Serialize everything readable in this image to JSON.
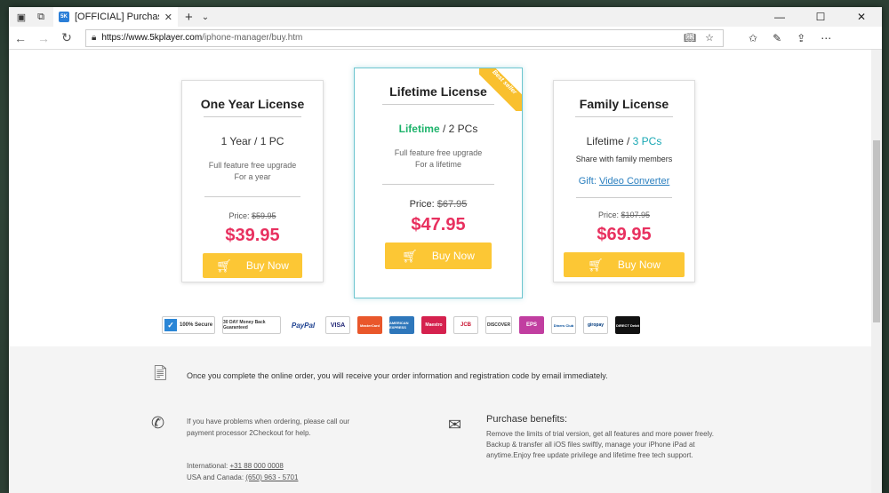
{
  "browser": {
    "tab_title": "[OFFICIAL] Purchase De",
    "tab_favicon": "5K",
    "url_host": "https://www.5kplayer.com",
    "url_path": "/iphone-manager/buy.htm"
  },
  "cards": [
    {
      "title": "One Year License",
      "term_left": "1 Year",
      "term_sep": " / ",
      "term_right": "1 PC",
      "desc1": "Full feature free upgrade",
      "desc2": "For a year",
      "price_label": "Price:",
      "old_price": "$59.95",
      "price": "$39.95",
      "buy_label": "Buy Now"
    },
    {
      "title": "Lifetime License",
      "term_left": "Lifetime",
      "term_sep": " / ",
      "term_right": "2 PCs",
      "desc1": "Full feature free upgrade",
      "desc2": "For a lifetime",
      "price_label": "Price:",
      "old_price": "$67.95",
      "price": "$47.95",
      "buy_label": "Buy Now",
      "ribbon": "Best seller"
    },
    {
      "title": "Family License",
      "term_left": "Lifetime",
      "term_sep": " / ",
      "term_right": "3 PCs",
      "desc1": "Share with family members",
      "gift_label": "Gift:",
      "gift_link": "Video Converter",
      "price_label": "Price:",
      "old_price": "$107.95",
      "price": "$69.95",
      "buy_label": "Buy Now"
    }
  ],
  "payments": [
    "100% Secure",
    "30 DAY Money Back Guaranteed",
    "PayPal",
    "VISA",
    "MasterCard",
    "AMERICAN EXPRESS",
    "Maestro",
    "JCB",
    "DISCOVER",
    "EPS",
    "Diners Club",
    "giropay",
    "DIRECT Debit"
  ],
  "info": {
    "notice": "Once you complete the online order, you will receive your order information and registration code by email immediately.",
    "help": "If you have problems when ordering, please call our payment processor 2Checkout for help.",
    "intl_label": "International:",
    "intl_phone": "+31 88 000 0008",
    "usa_label": "USA and Canada:",
    "usa_phone": "(650) 963 - 5701",
    "benefits_title": "Purchase benefits:",
    "benefits_text": "Remove the limits of trial version, get all features and more power freely. Backup & transfer all iOS files swiftly, manage your iPhone iPad at anytime.Enjoy free update privilege and lifetime free tech support."
  }
}
